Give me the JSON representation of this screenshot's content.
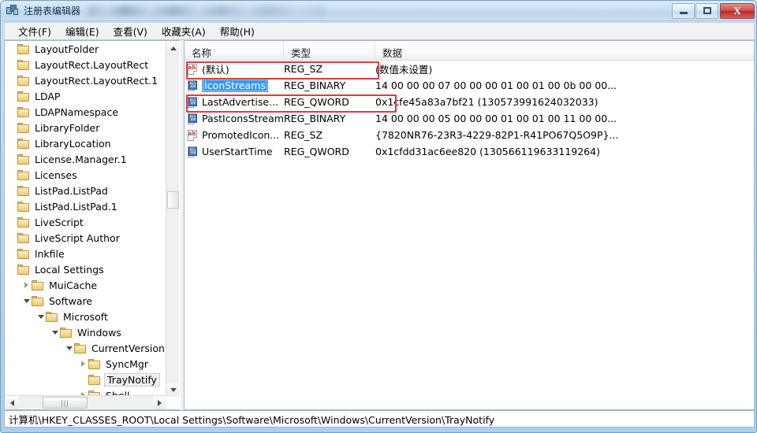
{
  "window": {
    "title": "注册表编辑器",
    "app_icon": "registry-editor-icon",
    "title_blur_note": "",
    "controls": {
      "minimize": "−",
      "maximize": "□",
      "close": "X"
    }
  },
  "menu": {
    "items": [
      {
        "label": "文件(F)"
      },
      {
        "label": "编辑(E)"
      },
      {
        "label": "查看(V)"
      },
      {
        "label": "收藏夹(A)"
      },
      {
        "label": "帮助(H)"
      }
    ]
  },
  "tree": {
    "nodes": [
      {
        "label": "LayoutFolder",
        "indent": 0,
        "arrow": "none",
        "selected": false
      },
      {
        "label": "LayoutRect.LayoutRect",
        "indent": 0,
        "arrow": "none",
        "selected": false
      },
      {
        "label": "LayoutRect.LayoutRect.1",
        "indent": 0,
        "arrow": "none",
        "selected": false
      },
      {
        "label": "LDAP",
        "indent": 0,
        "arrow": "none",
        "selected": false
      },
      {
        "label": "LDAPNamespace",
        "indent": 0,
        "arrow": "none",
        "selected": false
      },
      {
        "label": "LibraryFolder",
        "indent": 0,
        "arrow": "none",
        "selected": false
      },
      {
        "label": "LibraryLocation",
        "indent": 0,
        "arrow": "none",
        "selected": false
      },
      {
        "label": "License.Manager.1",
        "indent": 0,
        "arrow": "none",
        "selected": false
      },
      {
        "label": "Licenses",
        "indent": 0,
        "arrow": "none",
        "selected": false
      },
      {
        "label": "ListPad.ListPad",
        "indent": 0,
        "arrow": "none",
        "selected": false
      },
      {
        "label": "ListPad.ListPad.1",
        "indent": 0,
        "arrow": "none",
        "selected": false
      },
      {
        "label": "LiveScript",
        "indent": 0,
        "arrow": "none",
        "selected": false
      },
      {
        "label": "LiveScript Author",
        "indent": 0,
        "arrow": "none",
        "selected": false
      },
      {
        "label": "lnkfile",
        "indent": 0,
        "arrow": "none",
        "selected": false
      },
      {
        "label": "Local Settings",
        "indent": 0,
        "arrow": "none",
        "selected": false
      },
      {
        "label": "MuiCache",
        "indent": 1,
        "arrow": "collapsed",
        "selected": false
      },
      {
        "label": "Software",
        "indent": 1,
        "arrow": "expanded",
        "selected": false
      },
      {
        "label": "Microsoft",
        "indent": 2,
        "arrow": "expanded",
        "selected": false
      },
      {
        "label": "Windows",
        "indent": 3,
        "arrow": "expanded",
        "selected": false
      },
      {
        "label": "CurrentVersion",
        "indent": 4,
        "arrow": "expanded",
        "selected": false
      },
      {
        "label": "SyncMgr",
        "indent": 5,
        "arrow": "collapsed",
        "selected": false
      },
      {
        "label": "TrayNotify",
        "indent": 5,
        "arrow": "none",
        "selected": true
      },
      {
        "label": "Shell",
        "indent": 5,
        "arrow": "collapsed",
        "selected": false
      }
    ],
    "scrollbars": {
      "vertical_thumb": "vertical-scroll-thumb",
      "horizontal_thumb": "horizontal-scroll-thumb",
      "grip": "|||"
    }
  },
  "list": {
    "columns": [
      {
        "label": "名称"
      },
      {
        "label": "类型"
      },
      {
        "label": "数据"
      }
    ],
    "rows": [
      {
        "name": "(默认)",
        "type": "REG_SZ",
        "data": "(数值未设置)",
        "icon": "string-value-icon",
        "selected": false,
        "highlighted": false
      },
      {
        "name": "IconStreams",
        "type": "REG_BINARY",
        "data": "14 00 00 00 07 00 00 00 01 00 01 00 0b 00 00...",
        "icon": "binary-value-icon",
        "selected": true,
        "highlighted": true
      },
      {
        "name": "LastAdvertise...",
        "type": "REG_QWORD",
        "data": "0x1cfe45a83a7bf21 (130573991624032033)",
        "icon": "binary-value-icon",
        "selected": false,
        "highlighted": false
      },
      {
        "name": "PastIconsStream",
        "type": "REG_BINARY",
        "data": "14 00 00 00 05 00 00 00 01 00 01 00 11 00 00...",
        "icon": "binary-value-icon",
        "selected": false,
        "highlighted": true
      },
      {
        "name": "PromotedIcon...",
        "type": "REG_SZ",
        "data": "{7820NR76-23R3-4229-82P1-R41PO67Q5O9P}...",
        "icon": "string-value-icon",
        "selected": false,
        "highlighted": false
      },
      {
        "name": "UserStartTime",
        "type": "REG_QWORD",
        "data": "0x1cfdd31ac6ee820 (130566119633119264)",
        "icon": "binary-value-icon",
        "selected": false,
        "highlighted": false
      }
    ]
  },
  "statusbar": {
    "path": "计算机\\HKEY_CLASSES_ROOT\\Local Settings\\Software\\Microsoft\\Windows\\CurrentVersion\\TrayNotify"
  },
  "annotations": {
    "color": "#e03b3b",
    "boxes": [
      {
        "target": "IconStreams row",
        "label": "annotation-box-iconstreams"
      },
      {
        "target": "PastIconsStream row",
        "label": "annotation-box-pasticonsstream"
      }
    ]
  }
}
